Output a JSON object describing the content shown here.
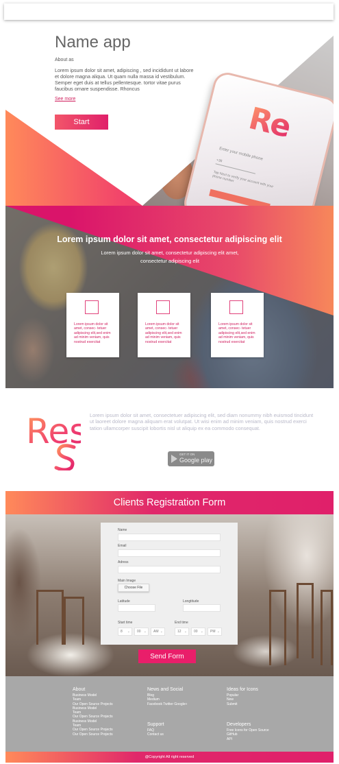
{
  "hero": {
    "app_name": "Name app",
    "about_label": "About as",
    "description": "Lorem ipsum dolor sit amet, adipiscing , sed incididunt ut labore et dolore magna aliqua. Ut quam nulla massa id vestibulum. Semper eget duis at tellus pellentesque. tortor vitae purus faucibus ornare suspendisse. Rhoncus",
    "see_more": "See more",
    "start_button": "Start",
    "phone": {
      "logo": "Re",
      "prompt": "Enter your mobile phone",
      "field_hint": "+38",
      "note": "Tap Next to verify your account with your phone number"
    },
    "accent_color": "#e0206a"
  },
  "feature": {
    "title": "Lorem ipsum dolor sit amet, consectetur adipiscing elit",
    "subtitle": "Lorem ipsum dolor sit amet, consectetur adipiscing elit amet, consectetur adipiscing elit",
    "cards": [
      {
        "icon": "square-outline-icon",
        "text": "Lorem ipsum dolor sit amet, consec- tetuer adipiscing elit,sed enim ad minim veniam, quis nostrud exercitat"
      },
      {
        "icon": "square-outline-icon",
        "text": "Lorem ipsum dolor sit amet, consec- tetuer adipiscing elit,sed enim ad minim veniam, quis nostrud exercitat"
      },
      {
        "icon": "square-outline-icon",
        "text": "Lorem ipsum dolor sit amet, consec- tetuer adipiscing elit,sed enim ad minim veniam, quis nostrud exercitat"
      }
    ]
  },
  "about_app": {
    "logo": "Res",
    "text": "Lorem ipsum dolor sit amet, consectetuer adipiscing elit, sed diam nonummy nibh euismod tincidunt ut laoreet dolore magna aliquam erat volutpat. Ut wisi enim ad minim veniam, quis nostrud exerci tation ullamcorper suscipit lobortis nisl ut aliquip ex ea commodo consequat.",
    "store_badge": {
      "small": "GET IT ON",
      "big": "Google play",
      "icon": "google-play-icon"
    }
  },
  "form": {
    "title": "Clients Registration Form",
    "fields": {
      "name": {
        "label": "Name",
        "value": ""
      },
      "email": {
        "label": "Email",
        "value": ""
      },
      "address": {
        "label": "Adress",
        "value": ""
      },
      "main_image": {
        "label": "Main Image",
        "button": "Choose File"
      },
      "latitude": {
        "label": "Latitude",
        "value": ""
      },
      "longitude": {
        "label": "Longtitude",
        "value": ""
      }
    },
    "start_time": {
      "label": "Start time",
      "hour": "8",
      "minute": "00",
      "period": "AM"
    },
    "end_time": {
      "label": "End time",
      "hour": "12",
      "minute": "00",
      "period": "PM"
    },
    "submit": "Send Form"
  },
  "footer": {
    "columns": [
      {
        "heading": "About",
        "links": [
          "Business Model",
          "Team",
          "Our Open Source Projects",
          "Business Model",
          "Team",
          "Our Open Source Projects",
          "Business Model",
          "Team",
          "Our Open Source Projects",
          "Our Open Source Projects"
        ]
      },
      {
        "heading": "News and Social",
        "links": [
          "Blog",
          "Medium",
          "Facebook  Twitter  Google+"
        ]
      },
      {
        "heading": "Ideas for Icons",
        "links": [
          "Popular",
          "New",
          "Submit"
        ]
      },
      {
        "heading": "Support",
        "links": [
          "FAQ",
          "Contact us"
        ]
      },
      {
        "heading": "Developers",
        "links": [
          "Free Icons for Open Source",
          "GitHub",
          "API"
        ]
      }
    ],
    "copyright": "@Copyright All right reserved"
  }
}
